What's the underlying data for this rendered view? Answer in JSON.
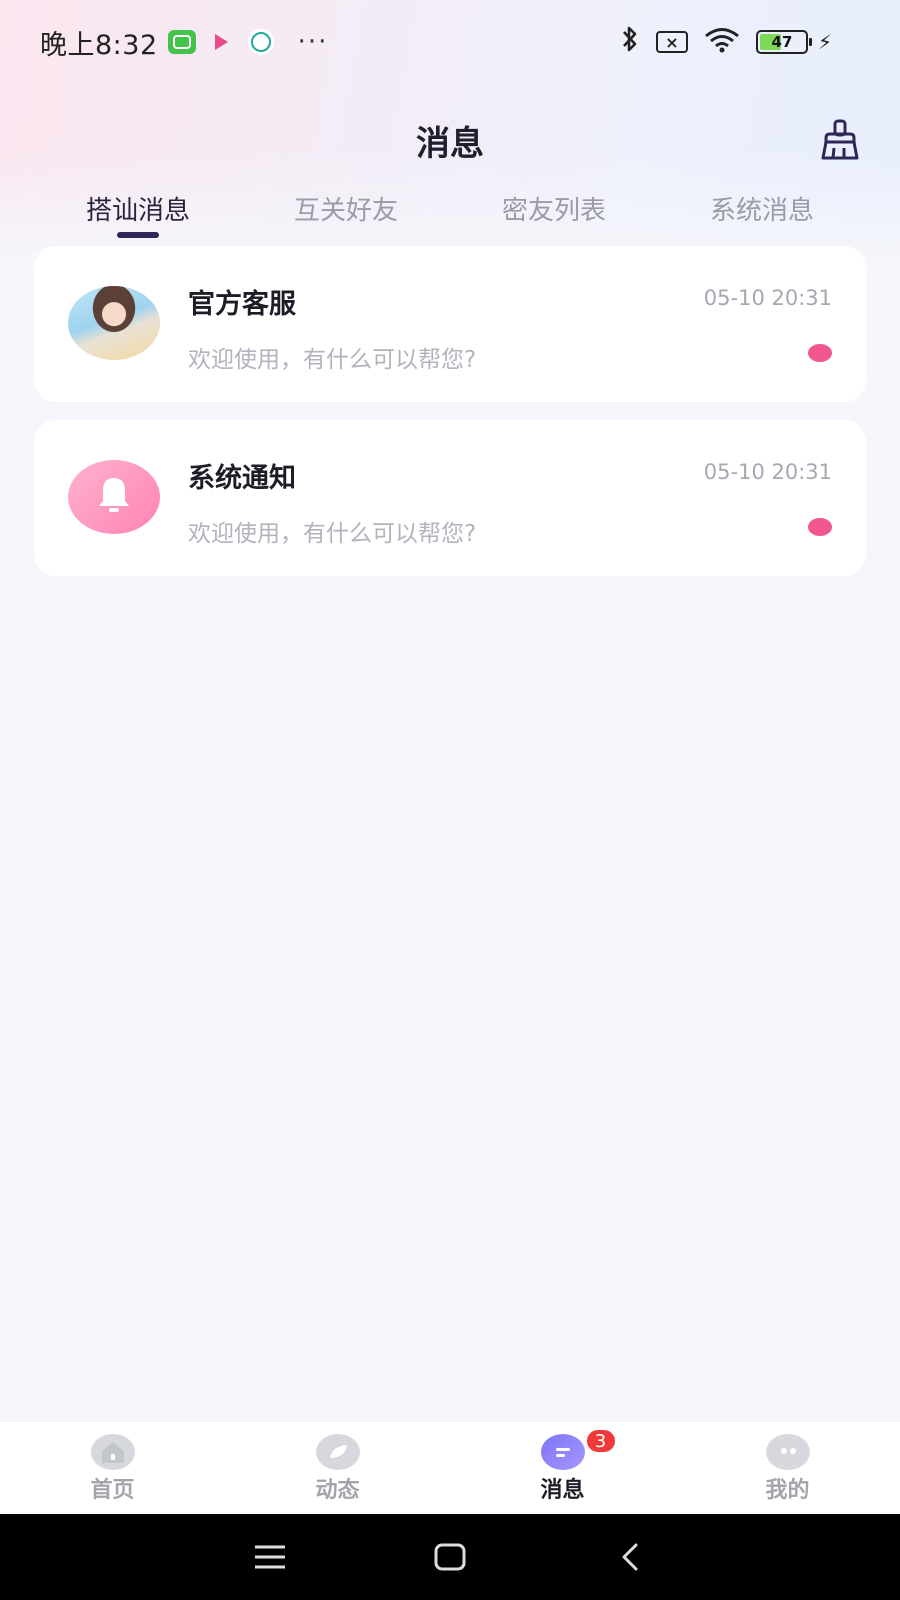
{
  "status_bar": {
    "time": "晚上8:32",
    "more": "···",
    "battery_level": "47",
    "battery_fraction": 0.47
  },
  "header": {
    "title": "消息",
    "action_icon": "broom-icon"
  },
  "tabs": [
    {
      "label": "搭讪消息",
      "active": true
    },
    {
      "label": "互关好友",
      "active": false
    },
    {
      "label": "密友列表",
      "active": false
    },
    {
      "label": "系统消息",
      "active": false
    }
  ],
  "messages": [
    {
      "name": "官方客服",
      "time": "05-10 20:31",
      "preview": "欢迎使用，有什么可以帮您?",
      "avatar": "photo",
      "unread": true
    },
    {
      "name": "系统通知",
      "time": "05-10 20:31",
      "preview": "欢迎使用，有什么可以帮您?",
      "avatar": "bell-icon",
      "unread": true
    }
  ],
  "bottom_nav": [
    {
      "label": "首页",
      "icon": "home-icon",
      "active": false
    },
    {
      "label": "动态",
      "icon": "feed-icon",
      "active": false
    },
    {
      "label": "消息",
      "icon": "chat-icon",
      "active": true,
      "badge": "3"
    },
    {
      "label": "我的",
      "icon": "profile-icon",
      "active": false
    }
  ],
  "colors": {
    "accent": "#2f2557",
    "unread_dot": "#f2578f",
    "badge": "#f03a3a",
    "active_nav_icon": "#8a7ff7"
  }
}
